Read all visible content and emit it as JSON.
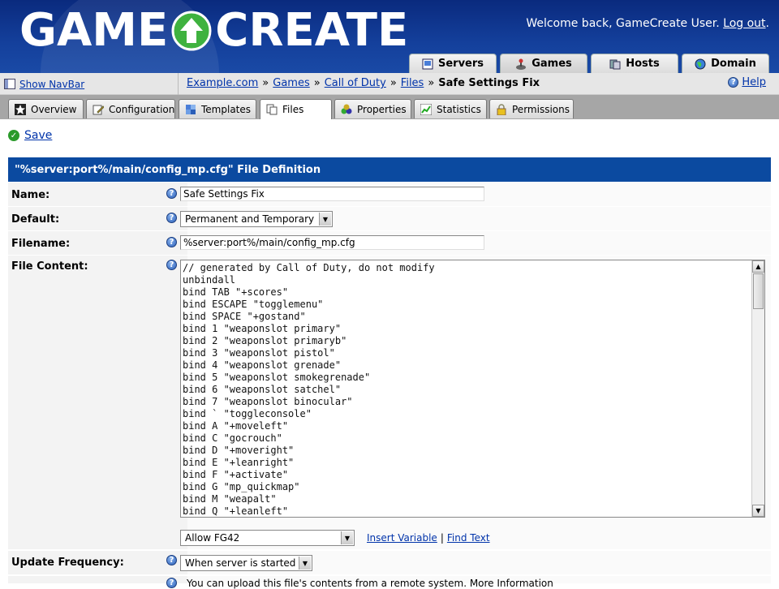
{
  "header": {
    "logo_left": "GAME",
    "logo_right": "CREATE",
    "welcome_text": "Welcome back, GameCreate User.",
    "logout_label": "Log out",
    "logout_suffix": "."
  },
  "main_tabs": [
    {
      "label": "Servers",
      "icon": "server-icon"
    },
    {
      "label": "Games",
      "icon": "joystick-icon",
      "active": true
    },
    {
      "label": "Hosts",
      "icon": "hosts-icon"
    },
    {
      "label": "Domain",
      "icon": "globe-icon"
    }
  ],
  "navbar_toggle": {
    "label": "Show NavBar",
    "icon": "navbar-icon"
  },
  "breadcrumb": {
    "items": [
      "Example.com",
      "Call of Duty"
    ],
    "games": "Games",
    "files": "Files",
    "current": "Safe Settings Fix",
    "separator": "»"
  },
  "help": {
    "label": "Help",
    "icon": "question-icon"
  },
  "sub_tabs": [
    {
      "label": "Overview",
      "icon": "star-icon"
    },
    {
      "label": "Configuration",
      "icon": "edit-icon"
    },
    {
      "label": "Templates",
      "icon": "puzzle-icon"
    },
    {
      "label": "Files",
      "icon": "files-icon",
      "active": true
    },
    {
      "label": "Properties",
      "icon": "properties-icon"
    },
    {
      "label": "Statistics",
      "icon": "chart-icon"
    },
    {
      "label": "Permissions",
      "icon": "lock-icon"
    }
  ],
  "save": {
    "label": "Save",
    "icon": "check-icon"
  },
  "form": {
    "title": "\"%server:port%/main/config_mp.cfg\" File Definition",
    "name": {
      "label": "Name:",
      "value": "Safe Settings Fix"
    },
    "default": {
      "label": "Default:",
      "value": "Permanent and Temporary"
    },
    "filename": {
      "label": "Filename:",
      "value": "%server:port%/main/config_mp.cfg"
    },
    "file_content": {
      "label": "File Content:",
      "lines": [
        "// generated by Call of Duty, do not modify",
        "unbindall",
        "bind TAB \"+scores\"",
        "bind ESCAPE \"togglemenu\"",
        "bind SPACE \"+gostand\"",
        "bind 1 \"weaponslot primary\"",
        "bind 2 \"weaponslot primaryb\"",
        "bind 3 \"weaponslot pistol\"",
        "bind 4 \"weaponslot grenade\"",
        "bind 5 \"weaponslot smokegrenade\"",
        "bind 6 \"weaponslot satchel\"",
        "bind 7 \"weaponslot binocular\"",
        "bind ` \"toggleconsole\"",
        "bind A \"+moveleft\"",
        "bind C \"gocrouch\"",
        "bind D \"+moveright\"",
        "bind E \"+leanright\"",
        "bind F \"+activate\"",
        "bind G \"mp_quickmap\"",
        "bind M \"weapalt\"",
        "bind Q \"+leanleft\""
      ]
    },
    "variable_select": "Allow FG42",
    "insert_variable": "Insert Variable",
    "find_text": "Find Text",
    "link_separator": "|",
    "update_frequency": {
      "label": "Update Frequency:",
      "value": "When server is started"
    },
    "bottom_note": "You can upload this file's contents from a remote system. More Information"
  },
  "colors": {
    "header_blue": "#14409c",
    "form_title_blue": "#0b4aa0",
    "link": "#0033aa"
  }
}
